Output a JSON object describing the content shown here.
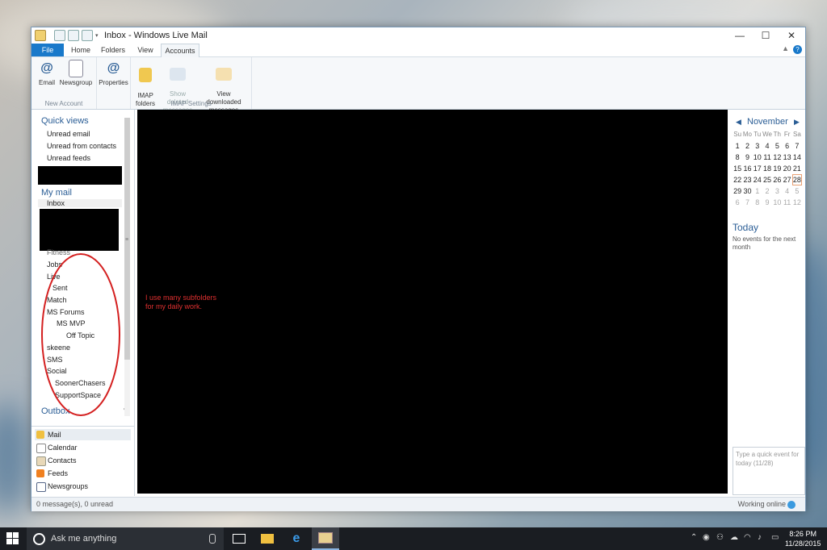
{
  "window": {
    "title": "Inbox - Windows Live Mail",
    "controls": {
      "minimize": "—",
      "maximize": "☐",
      "close": "✕"
    }
  },
  "ribbon": {
    "tabs": [
      "File",
      "Home",
      "Folders",
      "View",
      "Accounts"
    ],
    "active_tab": "Accounts",
    "groups": [
      {
        "label": "New Account",
        "buttons": [
          {
            "label": "Email"
          },
          {
            "label": "Newsgroup"
          }
        ]
      },
      {
        "label": "",
        "buttons": [
          {
            "label": "Properties"
          }
        ]
      },
      {
        "label": "IMAP Settings",
        "buttons": [
          {
            "label": "IMAP\nfolders"
          },
          {
            "label": "Show deleted\nmessages",
            "disabled": true
          },
          {
            "label": "View downloaded\nmessages"
          }
        ]
      }
    ]
  },
  "leftpane": {
    "quick_views": {
      "heading": "Quick views",
      "items": [
        "Unread email",
        "Unread from contacts",
        "Unread feeds"
      ]
    },
    "my_mail": {
      "heading": "My mail",
      "items": [
        "Inbox",
        "Fitness",
        "Jobs",
        "Live",
        "Sent",
        "Match",
        "MS Forums",
        "MS MVP",
        "Off Topic",
        "skeene",
        "SMS",
        "Social",
        "SoonerChasers",
        "SupportSpace"
      ]
    },
    "outbox": "Outbox",
    "switcher": [
      "Mail",
      "Calendar",
      "Contacts",
      "Feeds",
      "Newsgroups"
    ],
    "switcher_selected": "Mail"
  },
  "main": {
    "annotation": "I use many subfolders\nfor my daily work.",
    "annotation_color": "#e03030"
  },
  "calendar": {
    "month": "November",
    "prev": "◀",
    "next": "▶",
    "weekdays": [
      "Su",
      "Mo",
      "Tu",
      "We",
      "Th",
      "Fr",
      "Sa"
    ],
    "weeks": [
      [
        "1",
        "2",
        "3",
        "4",
        "5",
        "6",
        "7"
      ],
      [
        "8",
        "9",
        "10",
        "11",
        "12",
        "13",
        "14"
      ],
      [
        "15",
        "16",
        "17",
        "18",
        "19",
        "20",
        "21"
      ],
      [
        "22",
        "23",
        "24",
        "25",
        "26",
        "27",
        "28"
      ],
      [
        "29",
        "30",
        "1",
        "2",
        "3",
        "4",
        "5"
      ],
      [
        "6",
        "7",
        "8",
        "9",
        "10",
        "11",
        "12"
      ]
    ],
    "today_day": "28",
    "today_heading": "Today",
    "today_note": "No events for the next month",
    "quick_event_placeholder": "Type a quick event for today (11/28)"
  },
  "statusbar": {
    "left": "0 message(s), 0 unread",
    "right": "Working online"
  },
  "taskbar": {
    "search_placeholder": "Ask me anything",
    "time": "8:26 PM",
    "date": "11/28/2015"
  },
  "colors": {
    "accent": "#1979ca",
    "heading": "#2a5d95",
    "redaction": "#000000",
    "circle": "#d42020"
  }
}
